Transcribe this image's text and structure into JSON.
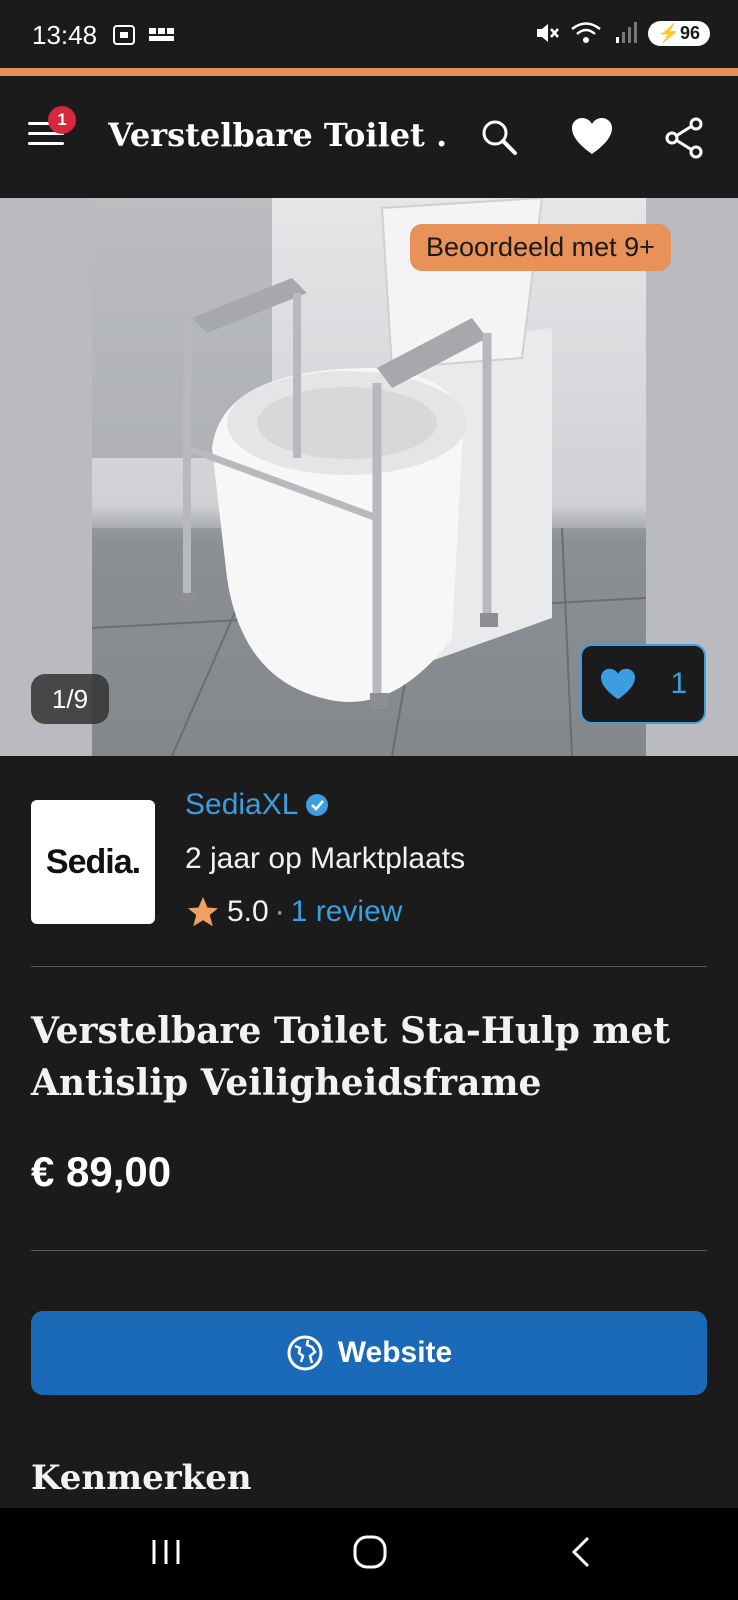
{
  "status_bar": {
    "time": "13:48",
    "battery": "96",
    "icons": [
      "screenshot-icon",
      "bbc-news-icon",
      "mute-icon",
      "wifi-icon",
      "signal-icon",
      "battery-icon"
    ]
  },
  "app_bar": {
    "menu_badge_count": "1",
    "title": "Verstelbare Toilet ...",
    "icons": [
      "menu-icon",
      "search-icon",
      "heart-icon",
      "share-icon"
    ]
  },
  "gallery": {
    "rated_badge": "Beoordeeld met 9+",
    "counter": "1/9",
    "like_count": "1"
  },
  "seller": {
    "logo_text": "Sedia.",
    "name": "SediaXL",
    "verified": true,
    "years": "2 jaar op Marktplaats",
    "rating": "5.0",
    "separator": "·",
    "reviews": "1 review"
  },
  "product": {
    "title": "Verstelbare Toilet Sta-Hulp met Antislip Veiligheidsframe",
    "price": "€ 89,00"
  },
  "actions": {
    "website_label": "Website"
  },
  "sections": {
    "features_heading": "Kenmerken"
  },
  "colors": {
    "background": "#1b1b1b",
    "accent_orange": "#e8925a",
    "link_blue": "#3a9ee0",
    "button_blue": "#1b6ab7",
    "badge_red": "#d7263d",
    "star": "#f0a060"
  }
}
